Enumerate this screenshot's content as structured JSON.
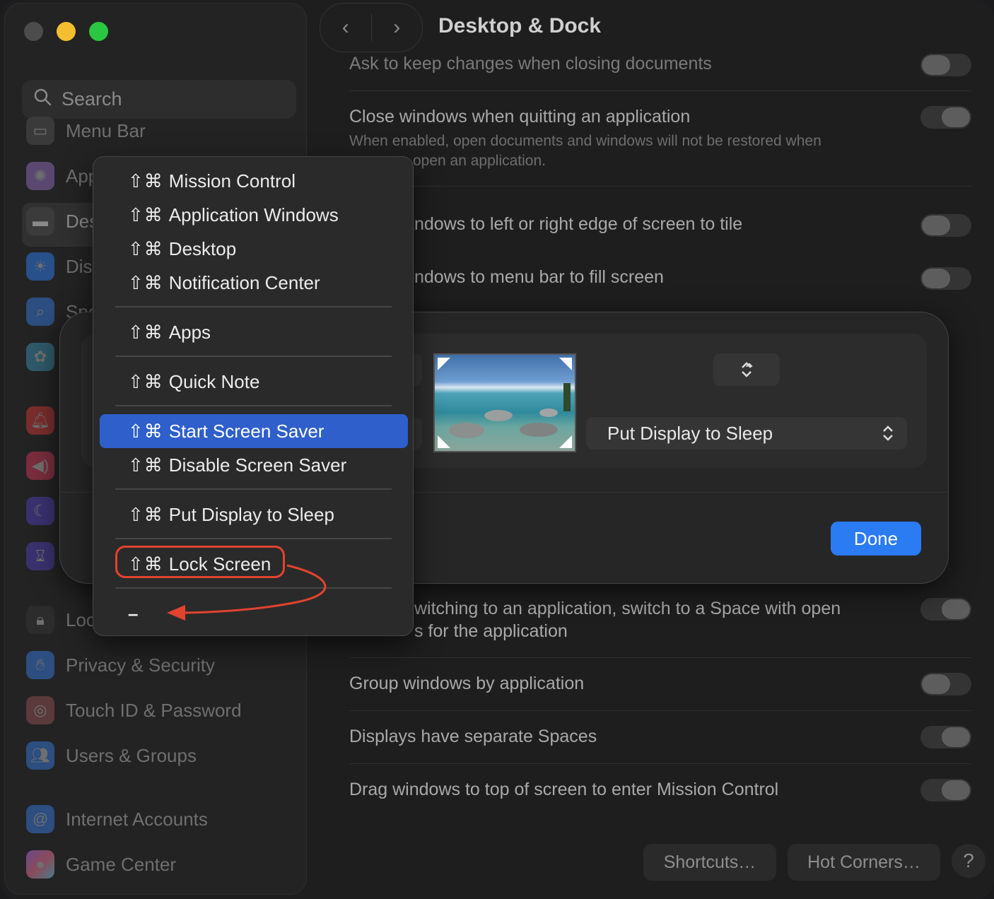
{
  "window": {
    "title": "Desktop & Dock",
    "colors": {
      "accent": "#2b7bf2",
      "highlight": "#2e5fcb",
      "callout": "#e2432f"
    }
  },
  "sidebar": {
    "search_placeholder": "Search",
    "items": [
      {
        "label": "Menu Bar",
        "icon": "menu-bar-icon"
      },
      {
        "label": "App",
        "icon": "appearance-icon"
      },
      {
        "label": "Des",
        "icon": "desktop-dock-icon",
        "selected": true
      },
      {
        "label": "Disp",
        "icon": "displays-icon"
      },
      {
        "label": "Spo",
        "icon": "spotlight-icon"
      },
      {
        "label": "",
        "icon": "siri-icon"
      },
      {
        "label": "",
        "icon": "notifications-icon"
      },
      {
        "label": "",
        "icon": "sound-icon"
      },
      {
        "label": "",
        "icon": "focus-icon"
      },
      {
        "label": "",
        "icon": "screen-time-icon"
      },
      {
        "label": "Loc",
        "icon": "lock-screen-icon"
      },
      {
        "label": "Privacy & Security",
        "icon": "privacy-hand-icon"
      },
      {
        "label": "Touch ID & Password",
        "icon": "fingerprint-icon"
      },
      {
        "label": "Users & Groups",
        "icon": "users-icon"
      },
      {
        "label": "Internet Accounts",
        "icon": "at-icon"
      },
      {
        "label": "Game Center",
        "icon": "game-center-icon"
      }
    ]
  },
  "settings": {
    "rows": [
      {
        "label": "Ask to keep changes when closing documents"
      },
      {
        "label": "Close windows when quitting an application",
        "sub_line1": "When enabled, open documents and windows will not be restored when",
        "sub_line2": "open an application."
      },
      {
        "label": "ndows to left or right edge of screen to tile"
      },
      {
        "label": "ndows to menu bar to fill screen"
      },
      {
        "label_line1": "witching to an application, switch to a Space with open",
        "label_line2": "s for the application"
      },
      {
        "label": "Group windows by application"
      },
      {
        "label": "Displays have separate Spaces"
      },
      {
        "label": "Drag windows to top of screen to enter Mission Control"
      }
    ],
    "shortcuts_button": "Shortcuts…",
    "hot_corners_button": "Hot Corners…",
    "help_button": "?"
  },
  "hot_corners_sheet": {
    "top_right_value": "",
    "bottom_right_value": "Put Display to Sleep",
    "done_label": "Done"
  },
  "menu": {
    "modifier_glyphs": "⇧⌘",
    "items": [
      {
        "label": "Mission Control"
      },
      {
        "label": "Application Windows"
      },
      {
        "label": "Desktop"
      },
      {
        "label": "Notification Center"
      },
      {
        "label": "Apps"
      },
      {
        "label": "Quick Note"
      },
      {
        "label": "Start Screen Saver",
        "highlighted": true
      },
      {
        "label": "Disable Screen Saver"
      },
      {
        "label": "Put Display to Sleep"
      },
      {
        "label": "Lock Screen",
        "annotated": true
      },
      {
        "label": "–"
      }
    ]
  }
}
